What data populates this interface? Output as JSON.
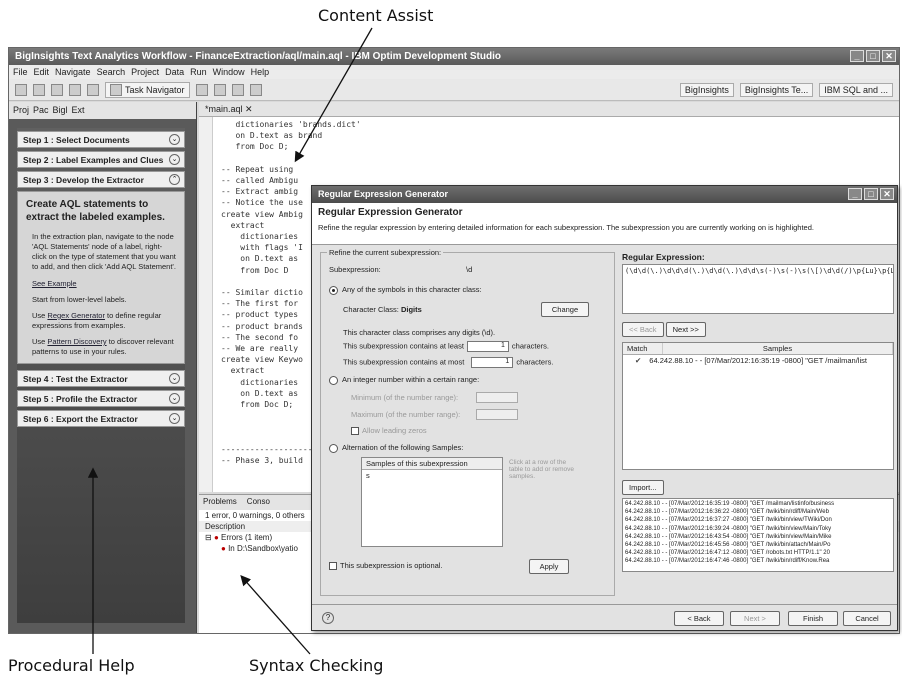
{
  "callouts": {
    "content_assist": "Content Assist",
    "procedural_help": "Procedural Help",
    "syntax_checking": "Syntax Checking"
  },
  "window": {
    "title": "BigInsights Text Analytics Workflow - FinanceExtraction/aql/main.aql - IBM Optim Development Studio",
    "menu": [
      "File",
      "Edit",
      "Navigate",
      "Search",
      "Project",
      "Data",
      "Run",
      "Window",
      "Help"
    ]
  },
  "toolbar": {
    "task_navigator": "Task Navigator",
    "perspectives": [
      "BigInsights",
      "BigInsights Te...",
      "IBM SQL and ..."
    ]
  },
  "left_tabs": [
    "Proj",
    "Pac",
    "Bigl",
    "Ext"
  ],
  "steps": {
    "step1": "Step 1 : Select Documents",
    "step2": "Step 2 : Label Examples and Clues",
    "step3": "Step 3 : Develop the Extractor",
    "heading": "Create AQL statements to extract the labeled examples.",
    "p1": "In the extraction plan, navigate to the node 'AQL Statements' node of a label, right-click on the type of statement that you want to add, and then click 'Add AQL Statement'.",
    "see_example": "See Example",
    "p2": "Start from lower-level labels.",
    "p3_pre": "Use ",
    "p3_link": "Regex Generator",
    "p3_post": " to define regular expressions from examples.",
    "p4_pre": "Use ",
    "p4_link": "Pattern Discovery",
    "p4_post": " to discover relevant patterns to use in your rules.",
    "step4": "Step 4 : Test the Extractor",
    "step5": "Step 5 : Profile the Extractor",
    "step6": "Step 6 : Export the Extractor"
  },
  "editor": {
    "tab": "*main.aql",
    "code": "   dictionaries 'brands.dict'\n   on D.text as brand\n   from Doc D;\n\n-- Repeat using\n-- called Ambigu\n-- Extract ambig\n-- Notice the use\ncreate view Ambig\n  extract\n    dictionaries\n    with flags 'I\n    on D.text as\n    from Doc D\n\n-- Similar dictio\n-- The first for\n-- product types\n-- product brands\n-- The second fo\n-- We are really\ncreate view Keywo\n  extract\n    dictionaries\n    on D.text as\n    from Doc D;\n\n\n\n-------------------\n-- Phase 3, build"
  },
  "problems": {
    "tabs": [
      "Problems",
      "Conso"
    ],
    "summary": "1 error, 0 warnings, 0 others",
    "column": "Description",
    "errors": "Errors (1 item)",
    "error_item": "In D:\\Sandbox\\yatio"
  },
  "dialog": {
    "title": "Regular Expression Generator",
    "header": "Regular Expression Generator",
    "description": "Refine the regular expression by entering detailed information for each subexpression. The subexpression you are currently working on is highlighted.",
    "refine_legend": "Refine the current subexpression:",
    "subexpression_label": "Subexpression:",
    "subexpression_value": "\\d",
    "any_symbols": "Any of the symbols in this character class:",
    "char_class_label": "Character Class:",
    "char_class_value": "Digits",
    "change_button": "Change",
    "comprises": "This character class comprises any digits (\\d).",
    "at_least_pre": "This subexpression contains at least",
    "at_least_value": "1",
    "at_most_pre": "This subexpression contains at most",
    "at_most_value": "1",
    "characters": "characters.",
    "integer_range": "An integer number within a certain range:",
    "minimum": "Minimum (of the number range):",
    "maximum": "Maximum (of the number range):",
    "leading_zeros": "Allow leading zeros",
    "alternation": "Alternation of the following Samples:",
    "samples_header": "Samples of this subexpression",
    "samples_first": "s",
    "click_hint": "Click at a row of the table to add or remove samples.",
    "optional": "This subexpression is optional.",
    "apply": "Apply",
    "regex_label": "Regular Expression:",
    "regex_value": "(\\d\\d(\\.)\\d\\d\\d(\\.)\\d\\d(\\.)\\d\\d\\s(-)\\s(-)\\s(\\[)\\d\\d(/)\\p{Lu}\\p{Ll}\\p{Ll}(/",
    "back_nav": "<< Back",
    "next_nav": "Next >>",
    "match_col": "Match",
    "samples_col": "Samples",
    "match_row": "64.242.88.10 - - [07/Mar/2012:16:35:19 -0800] \"GET /mailman/list",
    "import": "Import...",
    "sample_lines": [
      "64.242.88.10 - - [07/Mar/2012:16:35:19 -0800] \"GET /mailman/listinfo/business",
      "64.242.88.10 - - [07/Mar/2012:16:36:22 -0800] \"GET /twiki/bin/rdiff/Main/Web",
      "64.242.88.10 - - [07/Mar/2012:16:37:27 -0800] \"GET /twiki/bin/view/TWiki/Don",
      "64.242.88.10 - - [07/Mar/2012:16:39:24 -0800] \"GET /twiki/bin/view/Main/Toky",
      "64.242.88.10 - - [07/Mar/2012:16:43:54 -0800] \"GET /twiki/bin/view/Main/Mike",
      "64.242.88.10 - - [07/Mar/2012:16:45:56 -0800] \"GET /twiki/bin/attach/Main/Po",
      "64.242.88.10 - - [07/Mar/2012:16:47:12 -0800] \"GET /robots.txt HTTP/1.1\" 20",
      "64.242.88.10 - - [07/Mar/2012:16:47:46 -0800] \"GET /twiki/bin/rdiff/Know.Rea"
    ],
    "footer_back": "< Back",
    "footer_next": "Next >",
    "finish": "Finish",
    "cancel": "Cancel"
  }
}
